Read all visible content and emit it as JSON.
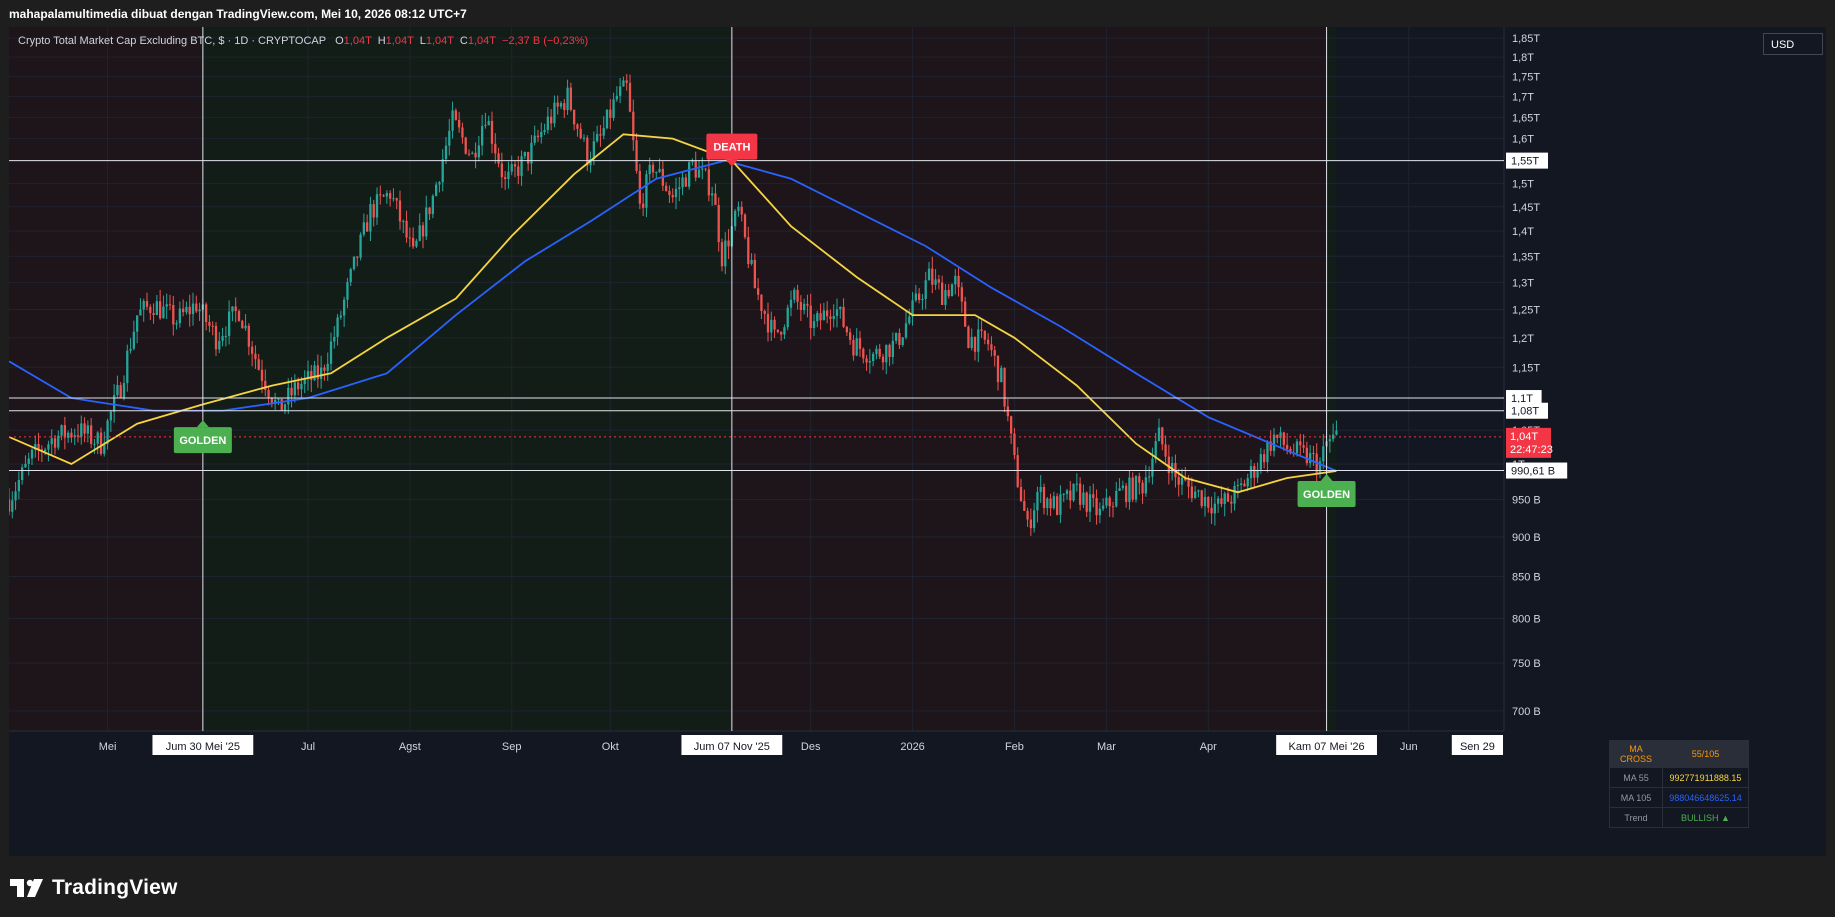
{
  "header": {
    "title": "mahapalamultimedia dibuat dengan TradingView.com, Mei 10, 2026 08:12 UTC+7"
  },
  "legend": {
    "symbol": "Crypto Total Market Cap Excluding BTC, $ · 1D · CRYPTOCAP",
    "open_label": "O",
    "open": "1,04T",
    "high_label": "H",
    "high": "1,04T",
    "low_label": "L",
    "low": "1,04T",
    "close_label": "C",
    "close": "1,04T",
    "change": "−2,37 B (−0,23%)"
  },
  "currency_button": "USD",
  "footer": {
    "brand": "TradingView"
  },
  "colors": {
    "background": "#131722",
    "up": "#26a69a",
    "down": "#ef5350",
    "ma55": "#f5d442",
    "ma105": "#2962ff",
    "golden": "#4caf50",
    "death": "#f23645",
    "bull_zone": "#131d18",
    "bear_zone": "#1d1519"
  },
  "ma_table": {
    "header_key": "MA CROSS",
    "header_value": "55/105",
    "rows": [
      {
        "key": "MA 55",
        "value": "992771911888.15",
        "color": "#f5d442"
      },
      {
        "key": "MA 105",
        "value": "988046648625.14",
        "color": "#2962ff"
      },
      {
        "key": "Trend",
        "value": "BULLISH ▲",
        "color": "#4caf50"
      }
    ]
  },
  "chart_data": {
    "type": "candlestick",
    "title": "Crypto Total Market Cap Excluding BTC, $ · 1D · CRYPTOCAP",
    "y_unit": "USD",
    "ylim": [
      680000000000,
      1880000000000
    ],
    "y_ticks": [
      "1,85T",
      "1,8T",
      "1,75T",
      "1,7T",
      "1,65T",
      "1,6T",
      "1,55T",
      "1,5T",
      "1,45T",
      "1,4T",
      "1,35T",
      "1,3T",
      "1,25T",
      "1,2T",
      "1,15T",
      "1,1T",
      "1,05T",
      "1T",
      "950 B",
      "900 B",
      "850 B",
      "800 B",
      "750 B",
      "700 B"
    ],
    "y_tick_values": [
      1.85,
      1.8,
      1.75,
      1.7,
      1.65,
      1.6,
      1.55,
      1.5,
      1.45,
      1.4,
      1.35,
      1.3,
      1.25,
      1.2,
      1.15,
      1.1,
      1.05,
      1.0,
      0.95,
      0.9,
      0.85,
      0.8,
      0.75,
      0.7
    ],
    "x_labels": [
      {
        "label": "Mei",
        "date": "2025-05-01"
      },
      {
        "label": "Jul",
        "date": "2025-07-01"
      },
      {
        "label": "Agst",
        "date": "2025-08-01"
      },
      {
        "label": "Sep",
        "date": "2025-09-01"
      },
      {
        "label": "Okt",
        "date": "2025-10-01"
      },
      {
        "label": "Des",
        "date": "2025-12-01"
      },
      {
        "label": "2026",
        "date": "2026-01-01"
      },
      {
        "label": "Feb",
        "date": "2026-02-01"
      },
      {
        "label": "Mar",
        "date": "2026-03-01"
      },
      {
        "label": "Apr",
        "date": "2026-04-01"
      },
      {
        "label": "Jun",
        "date": "2026-06-01"
      }
    ],
    "x_highlight_labels": [
      {
        "label": "Jum 30 Mei '25",
        "date": "2025-05-30"
      },
      {
        "label": "Jum 07 Nov '25",
        "date": "2025-11-07"
      },
      {
        "label": "Kam 07 Mei '26",
        "date": "2026-05-07"
      },
      {
        "label": "Sen 29",
        "date": "2026-06-29"
      }
    ],
    "x_range": [
      "2025-04-01",
      "2026-06-30"
    ],
    "last_date": "2026-05-10",
    "price_path": [
      [
        "2025-04-01",
        0.95
      ],
      [
        "2025-04-08",
        1.01
      ],
      [
        "2025-04-15",
        1.04
      ],
      [
        "2025-04-22",
        1.05
      ],
      [
        "2025-04-29",
        1.03
      ],
      [
        "2025-05-05",
        1.12
      ],
      [
        "2025-05-10",
        1.24
      ],
      [
        "2025-05-15",
        1.26
      ],
      [
        "2025-05-22",
        1.23
      ],
      [
        "2025-05-28",
        1.26
      ],
      [
        "2025-06-03",
        1.2
      ],
      [
        "2025-06-10",
        1.25
      ],
      [
        "2025-06-16",
        1.15
      ],
      [
        "2025-06-22",
        1.08
      ],
      [
        "2025-06-28",
        1.12
      ],
      [
        "2025-07-05",
        1.14
      ],
      [
        "2025-07-10",
        1.22
      ],
      [
        "2025-07-15",
        1.33
      ],
      [
        "2025-07-20",
        1.44
      ],
      [
        "2025-07-26",
        1.48
      ],
      [
        "2025-08-02",
        1.35
      ],
      [
        "2025-08-08",
        1.47
      ],
      [
        "2025-08-14",
        1.64
      ],
      [
        "2025-08-20",
        1.56
      ],
      [
        "2025-08-24",
        1.66
      ],
      [
        "2025-08-30",
        1.5
      ],
      [
        "2025-09-06",
        1.56
      ],
      [
        "2025-09-12",
        1.64
      ],
      [
        "2025-09-18",
        1.7
      ],
      [
        "2025-09-24",
        1.56
      ],
      [
        "2025-09-28",
        1.6
      ],
      [
        "2025-10-03",
        1.7
      ],
      [
        "2025-10-06",
        1.72
      ],
      [
        "2025-10-10",
        1.45
      ],
      [
        "2025-10-14",
        1.54
      ],
      [
        "2025-10-20",
        1.47
      ],
      [
        "2025-10-26",
        1.54
      ],
      [
        "2025-11-01",
        1.49
      ],
      [
        "2025-11-04",
        1.35
      ],
      [
        "2025-11-09",
        1.44
      ],
      [
        "2025-11-14",
        1.29
      ],
      [
        "2025-11-20",
        1.2
      ],
      [
        "2025-11-26",
        1.27
      ],
      [
        "2025-12-02",
        1.22
      ],
      [
        "2025-12-08",
        1.26
      ],
      [
        "2025-12-14",
        1.19
      ],
      [
        "2025-12-20",
        1.17
      ],
      [
        "2025-12-27",
        1.19
      ],
      [
        "2026-01-02",
        1.26
      ],
      [
        "2026-01-06",
        1.31
      ],
      [
        "2026-01-10",
        1.28
      ],
      [
        "2026-01-14",
        1.3
      ],
      [
        "2026-01-18",
        1.2
      ],
      [
        "2026-01-24",
        1.19
      ],
      [
        "2026-01-28",
        1.13
      ],
      [
        "2026-02-01",
        1.0
      ],
      [
        "2026-02-05",
        0.91
      ],
      [
        "2026-02-08",
        0.96
      ],
      [
        "2026-02-14",
        0.94
      ],
      [
        "2026-02-20",
        0.96
      ],
      [
        "2026-02-27",
        0.93
      ],
      [
        "2026-03-05",
        0.96
      ],
      [
        "2026-03-12",
        0.97
      ],
      [
        "2026-03-17",
        1.04
      ],
      [
        "2026-03-22",
        0.98
      ],
      [
        "2026-03-28",
        0.96
      ],
      [
        "2026-04-04",
        0.94
      ],
      [
        "2026-04-10",
        0.96
      ],
      [
        "2026-04-16",
        1.0
      ],
      [
        "2026-04-21",
        1.04
      ],
      [
        "2026-04-26",
        1.02
      ],
      [
        "2026-05-01",
        1.01
      ],
      [
        "2026-05-05",
        1.0
      ],
      [
        "2026-05-07",
        1.03
      ],
      [
        "2026-05-10",
        1.04
      ]
    ],
    "ma55_path": [
      [
        "2025-04-01",
        1.04
      ],
      [
        "2025-04-20",
        1.0
      ],
      [
        "2025-05-10",
        1.06
      ],
      [
        "2025-05-30",
        1.09
      ],
      [
        "2025-06-20",
        1.12
      ],
      [
        "2025-07-08",
        1.14
      ],
      [
        "2025-07-25",
        1.2
      ],
      [
        "2025-08-15",
        1.27
      ],
      [
        "2025-09-01",
        1.39
      ],
      [
        "2025-09-20",
        1.52
      ],
      [
        "2025-10-05",
        1.61
      ],
      [
        "2025-10-20",
        1.6
      ],
      [
        "2025-11-07",
        1.55
      ],
      [
        "2025-11-25",
        1.41
      ],
      [
        "2025-12-15",
        1.31
      ],
      [
        "2026-01-01",
        1.24
      ],
      [
        "2026-01-20",
        1.24
      ],
      [
        "2026-02-01",
        1.2
      ],
      [
        "2026-02-20",
        1.12
      ],
      [
        "2026-03-10",
        1.03
      ],
      [
        "2026-03-25",
        0.98
      ],
      [
        "2026-04-10",
        0.96
      ],
      [
        "2026-04-25",
        0.98
      ],
      [
        "2026-05-10",
        0.99
      ]
    ],
    "ma105_path": [
      [
        "2025-04-01",
        1.16
      ],
      [
        "2025-04-20",
        1.1
      ],
      [
        "2025-05-15",
        1.08
      ],
      [
        "2025-06-05",
        1.08
      ],
      [
        "2025-07-01",
        1.1
      ],
      [
        "2025-07-25",
        1.14
      ],
      [
        "2025-08-15",
        1.24
      ],
      [
        "2025-09-05",
        1.34
      ],
      [
        "2025-09-25",
        1.42
      ],
      [
        "2025-10-15",
        1.51
      ],
      [
        "2025-11-05",
        1.55
      ],
      [
        "2025-11-25",
        1.51
      ],
      [
        "2025-12-15",
        1.44
      ],
      [
        "2026-01-05",
        1.37
      ],
      [
        "2026-01-25",
        1.29
      ],
      [
        "2026-02-15",
        1.22
      ],
      [
        "2026-03-10",
        1.14
      ],
      [
        "2026-04-01",
        1.07
      ],
      [
        "2026-04-25",
        1.02
      ],
      [
        "2026-05-10",
        0.99
      ]
    ],
    "horizontal_lines": [
      {
        "value": 1.55,
        "label": "1,55T"
      },
      {
        "value": 1.1,
        "label": "1,1T"
      },
      {
        "value": 1.08,
        "label": "1,08T"
      },
      {
        "value": 0.99061,
        "label": "990,61 B"
      }
    ],
    "current_price": {
      "value": 1.04,
      "label": "1,04T",
      "countdown": "22:47:23"
    },
    "vertical_lines": [
      "2025-05-30",
      "2025-11-07",
      "2026-05-07"
    ],
    "zones": [
      {
        "from": "2025-04-01",
        "to": "2025-05-30",
        "trend": "bear"
      },
      {
        "from": "2025-05-30",
        "to": "2025-11-07",
        "trend": "bull"
      },
      {
        "from": "2025-11-07",
        "to": "2026-05-07",
        "trend": "bear"
      },
      {
        "from": "2026-05-07",
        "to": "2026-05-10",
        "trend": "bull"
      }
    ],
    "signals": [
      {
        "label": "GOLDEN",
        "date": "2025-05-30",
        "value": 1.07,
        "kind": "golden",
        "placement": "below"
      },
      {
        "label": "DEATH",
        "date": "2025-11-07",
        "value": 1.53,
        "kind": "death",
        "placement": "above"
      },
      {
        "label": "GOLDEN",
        "date": "2026-05-07",
        "value": 0.99,
        "kind": "golden",
        "placement": "below"
      }
    ],
    "grid": true,
    "legend_position": "top-left"
  }
}
